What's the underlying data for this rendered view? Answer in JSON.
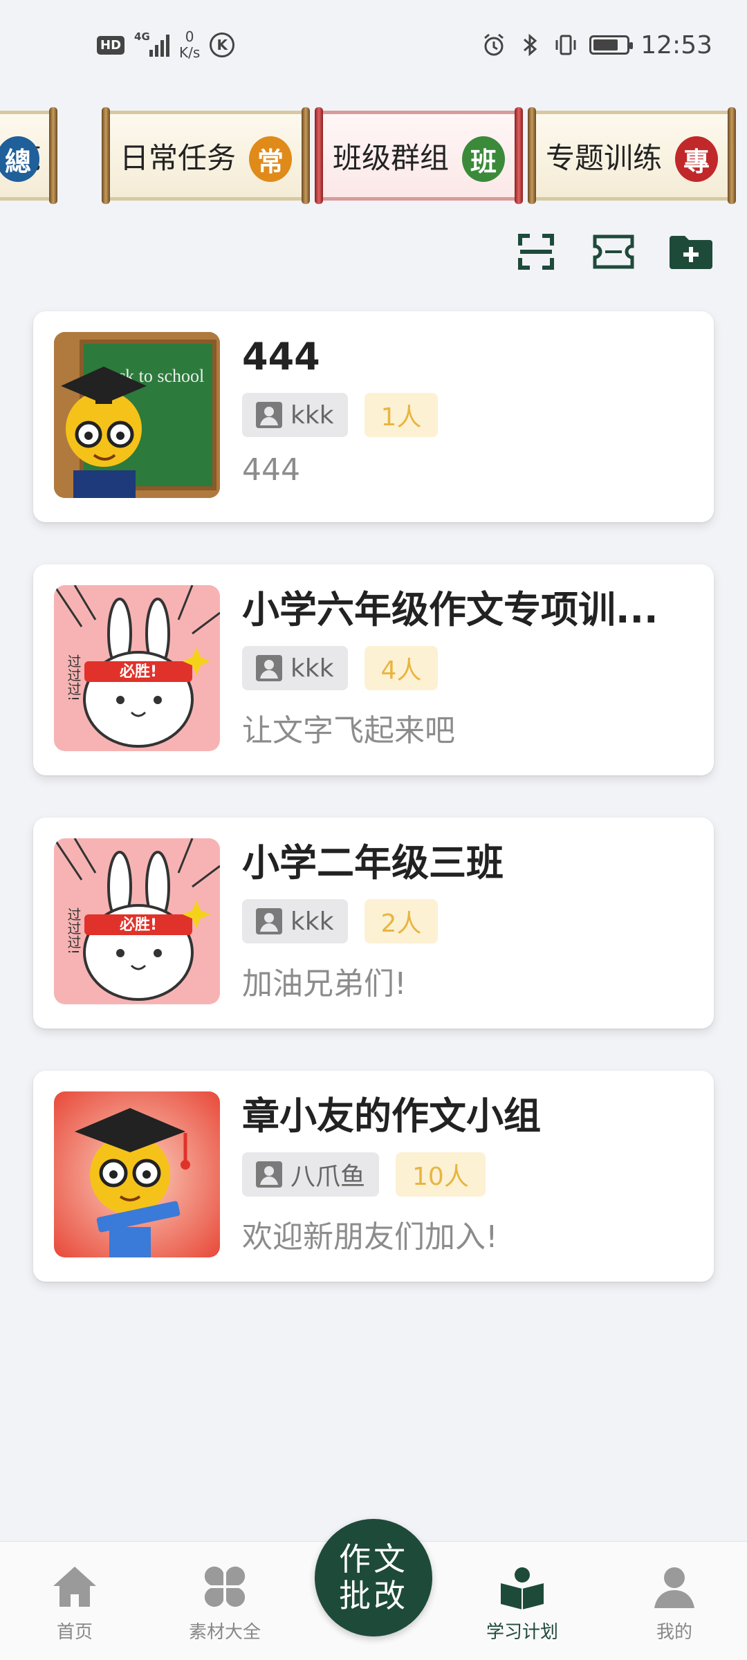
{
  "status_bar": {
    "hd": "HD",
    "network": "4G",
    "speed_value": "0",
    "speed_unit": "K/s",
    "k_icon": "K",
    "time": "12:53",
    "battery_level": 0.75
  },
  "tabs": [
    {
      "label": "览",
      "seal": "總",
      "seal_color": "#1f5f9a",
      "icon": "seal-zong-icon"
    },
    {
      "label": "日常任务",
      "seal": "常",
      "seal_color": "#e08a1a",
      "icon": "seal-chang-icon"
    },
    {
      "label": "班级群组",
      "seal": "班",
      "seal_color": "#3a8a3a",
      "icon": "seal-ban-icon"
    },
    {
      "label": "专题训练",
      "seal": "專",
      "seal_color": "#c0282a",
      "icon": "seal-zhuan-icon"
    }
  ],
  "active_tab_index": 2,
  "toolbar": {
    "icons": [
      "scan-icon",
      "ticket-icon",
      "folder-add-icon"
    ]
  },
  "groups": [
    {
      "title": "444",
      "owner": "kkk",
      "members": "1人",
      "desc": "444",
      "avatar": "back-to-school-avatar"
    },
    {
      "title": "小学六年级作文专项训...",
      "owner": "kkk",
      "members": "4人",
      "desc": "让文字飞起来吧",
      "avatar": "bunny-avatar"
    },
    {
      "title": "小学二年级三班",
      "owner": "kkk",
      "members": "2人",
      "desc": "加油兄弟们!",
      "avatar": "bunny-avatar"
    },
    {
      "title": "章小友的作文小组",
      "owner": "八爪鱼",
      "members": "10人",
      "desc": "欢迎新朋友们加入!",
      "avatar": "graduate-avatar"
    }
  ],
  "avatar_texts": {
    "back_to_school": "Back to school",
    "bunny_headband": "必胜!",
    "bunny_side": "过过过!"
  },
  "bottom_nav": {
    "items": [
      {
        "label": "首页",
        "icon": "home-icon"
      },
      {
        "label": "素材大全",
        "icon": "clover-icon"
      },
      {
        "label": "学习计划",
        "icon": "book-icon"
      },
      {
        "label": "我的",
        "icon": "person-icon"
      }
    ],
    "center_line1": "作文",
    "center_line2": "批改",
    "active_index": 2
  },
  "colors": {
    "primary": "#1e4a3a",
    "count_text": "#e8b540",
    "count_bg": "#fdf1d4",
    "inactive": "#888888"
  }
}
